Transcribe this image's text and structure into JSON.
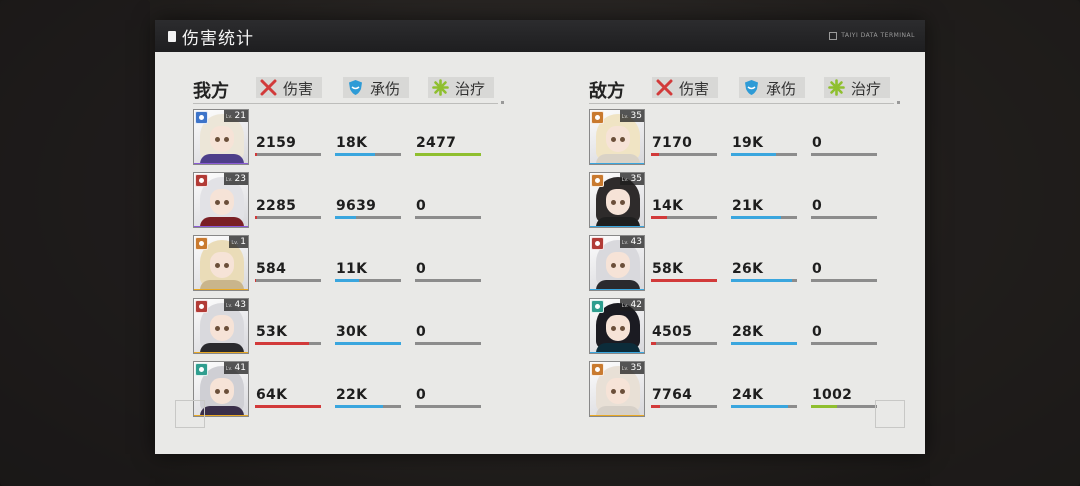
{
  "title": "伤害统计",
  "terminal_label": "TAIYI DATA TERMINAL",
  "stat_headers": [
    {
      "label": "伤害",
      "icon": "crossed-swords-icon",
      "color": "#d23a3a"
    },
    {
      "label": "承伤",
      "icon": "shield-icon",
      "color": "#2e9bd6"
    },
    {
      "label": "治疗",
      "icon": "heal-burst-icon",
      "color": "#8fbf2f"
    }
  ],
  "bar_colors": {
    "damage": "#d23a3a",
    "taken": "#3aa6de",
    "heal": "#8fbf2f"
  },
  "ally": {
    "label": "我方",
    "units": [
      {
        "level": "21",
        "damage": "2159",
        "taken": "18K",
        "heal": "2477",
        "damage_fill": 0.03,
        "taken_fill": 0.6,
        "heal_fill": 1.0,
        "class_color": "#3d74c9",
        "rarity_color": "#8b5bd6",
        "hair": "#ece6d8",
        "outfit": "#4e3f8a"
      },
      {
        "level": "23",
        "damage": "2285",
        "taken": "9639",
        "heal": "0",
        "damage_fill": 0.03,
        "taken_fill": 0.32,
        "heal_fill": 0,
        "class_color": "#b23b36",
        "rarity_color": "#8b5bd6",
        "hair": "#e2e2e6",
        "outfit": "#7a1f25"
      },
      {
        "level": "1",
        "damage": "584",
        "taken": "11K",
        "heal": "0",
        "damage_fill": 0.01,
        "taken_fill": 0.37,
        "heal_fill": 0,
        "class_color": "#c97a2f",
        "rarity_color": "#e8a824",
        "hair": "#eadcb8",
        "outfit": "#c9b58c"
      },
      {
        "level": "43",
        "damage": "53K",
        "taken": "30K",
        "heal": "0",
        "damage_fill": 0.82,
        "taken_fill": 1.0,
        "heal_fill": 0,
        "class_color": "#b23b36",
        "rarity_color": "#e8a824",
        "hair": "#d9d9dd",
        "outfit": "#2a2a2e"
      },
      {
        "level": "41",
        "damage": "64K",
        "taken": "22K",
        "heal": "0",
        "damage_fill": 1.0,
        "taken_fill": 0.73,
        "heal_fill": 0,
        "class_color": "#2f9e8f",
        "rarity_color": "#e8a824",
        "hair": "#cfcfd4",
        "outfit": "#3a2f4a"
      }
    ]
  },
  "enemy": {
    "label": "敌方",
    "units": [
      {
        "level": "35",
        "damage": "7170",
        "taken": "19K",
        "heal": "0",
        "damage_fill": 0.12,
        "taken_fill": 0.68,
        "heal_fill": 0,
        "class_color": "#c97a2f",
        "rarity_color": "#3aa6de",
        "hair": "#f0e4c4",
        "outfit": "#d9d2c6"
      },
      {
        "level": "35",
        "damage": "14K",
        "taken": "21K",
        "heal": "0",
        "damage_fill": 0.24,
        "taken_fill": 0.75,
        "heal_fill": 0,
        "class_color": "#c97a2f",
        "rarity_color": "#3aa6de",
        "hair": "#2e2b2b",
        "outfit": "#1f1f1f"
      },
      {
        "level": "43",
        "damage": "58K",
        "taken": "26K",
        "heal": "0",
        "damage_fill": 1.0,
        "taken_fill": 0.93,
        "heal_fill": 0,
        "class_color": "#b23b36",
        "rarity_color": "#3aa6de",
        "hair": "#d9d9dd",
        "outfit": "#2a2a2e"
      },
      {
        "level": "42",
        "damage": "4505",
        "taken": "28K",
        "heal": "0",
        "damage_fill": 0.08,
        "taken_fill": 1.0,
        "heal_fill": 0,
        "class_color": "#2f9e8f",
        "rarity_color": "#3aa6de",
        "hair": "#1b1b22",
        "outfit": "#0c2c3a"
      },
      {
        "level": "35",
        "damage": "7764",
        "taken": "24K",
        "heal": "1002",
        "damage_fill": 0.13,
        "taken_fill": 0.86,
        "heal_fill": 0.4,
        "class_color": "#c97a2f",
        "rarity_color": "#e8a824",
        "hair": "#e8e0d6",
        "outfit": "#d6d0c8"
      }
    ]
  }
}
